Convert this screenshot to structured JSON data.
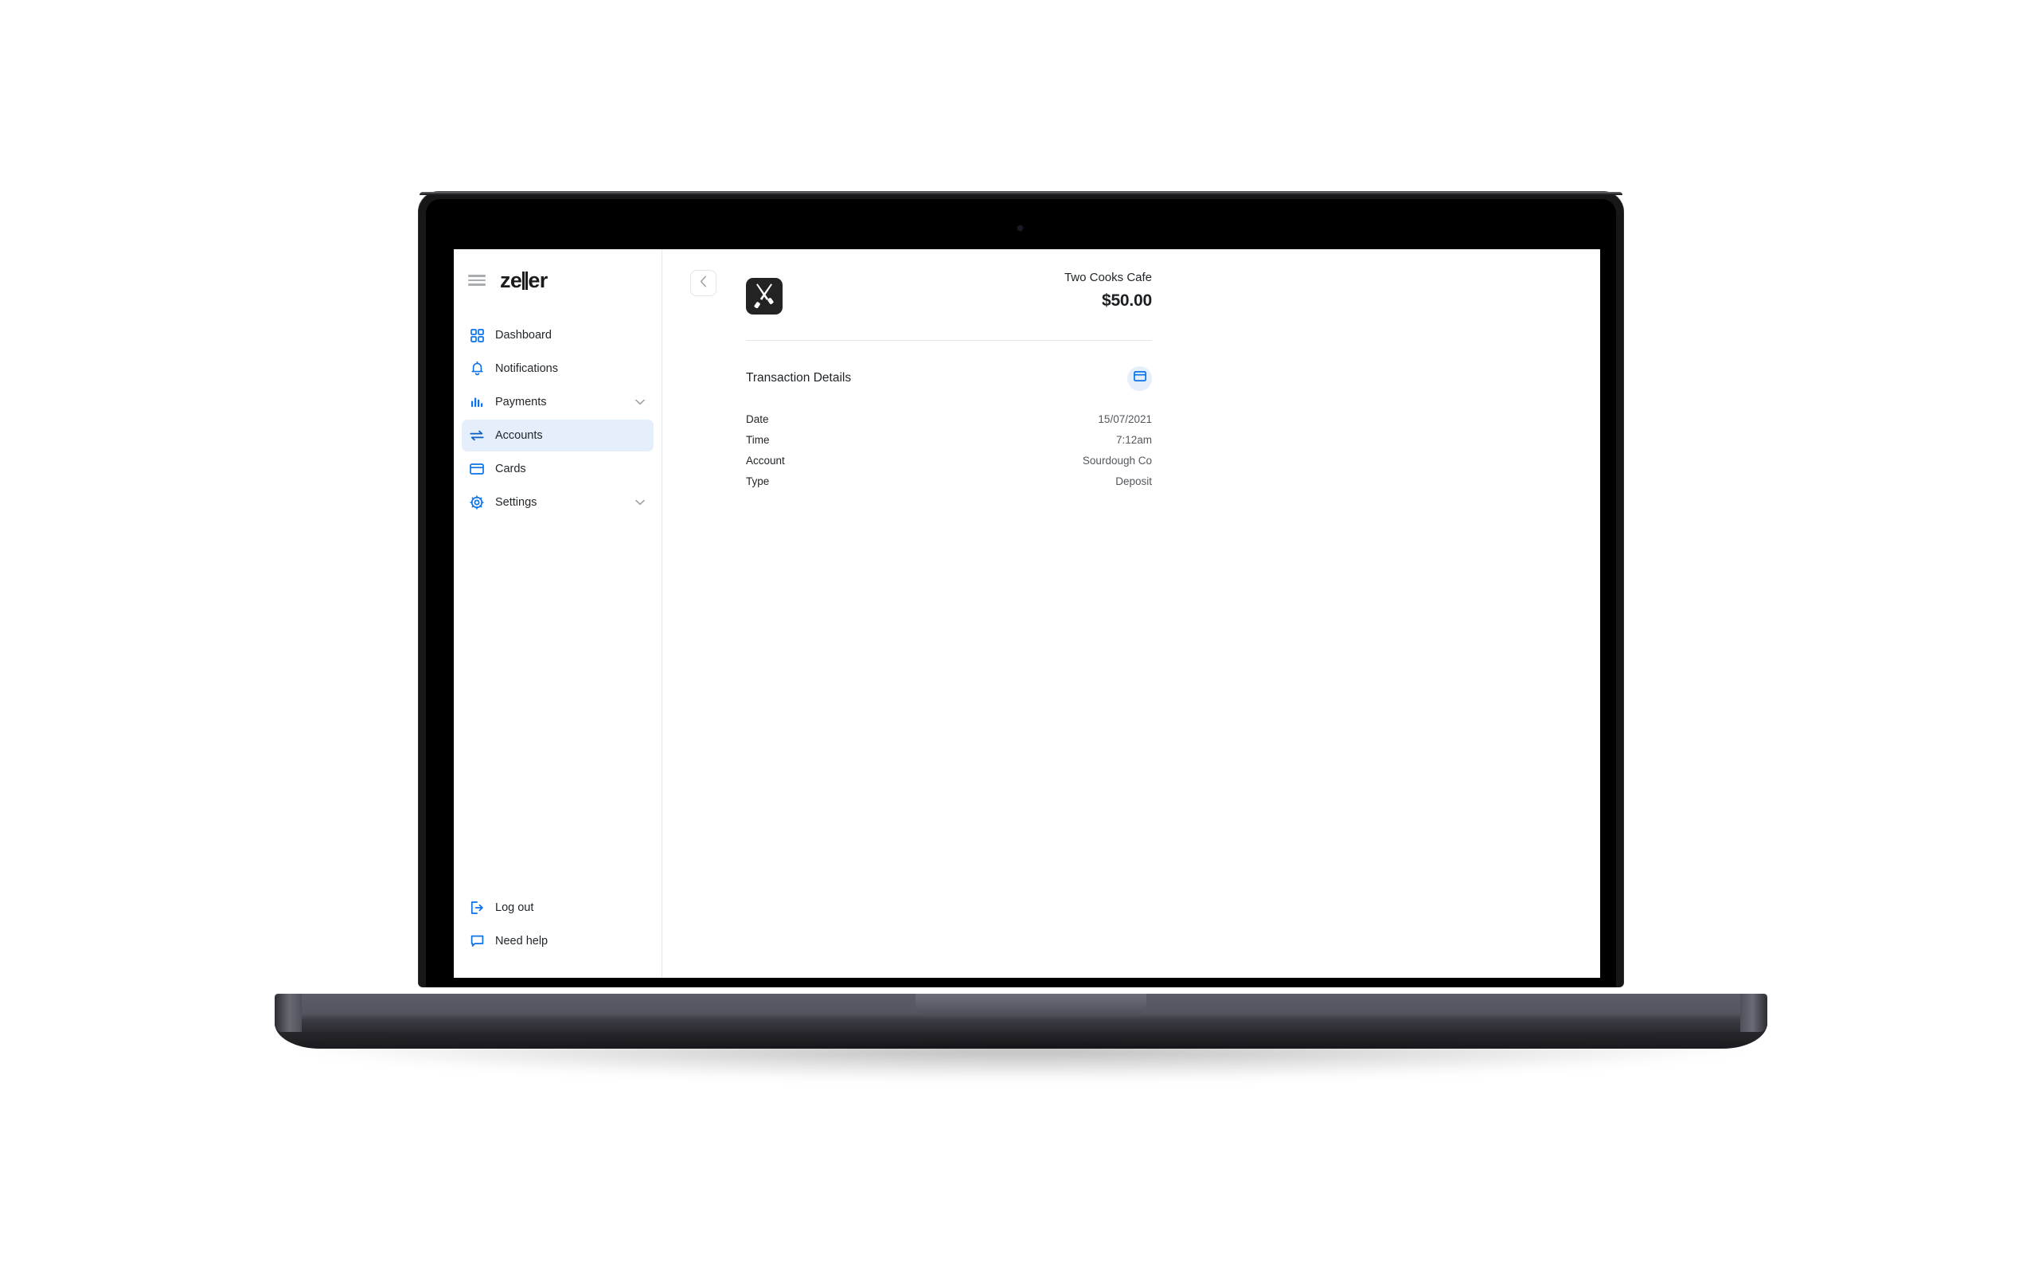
{
  "brand": {
    "name": "zeller",
    "name_part1": "ze",
    "name_part2": "er",
    "accent_color": "#0b72e7",
    "active_nav_bg": "#e4effb"
  },
  "sidebar": {
    "menu_icon": "hamburger-icon",
    "nav_items": [
      {
        "label": "Dashboard",
        "icon": "dashboard-grid-icon",
        "active": false,
        "expandable": false
      },
      {
        "label": "Notifications",
        "icon": "bell-icon",
        "active": false,
        "expandable": false
      },
      {
        "label": "Payments",
        "icon": "bar-chart-icon",
        "active": false,
        "expandable": true
      },
      {
        "label": "Accounts",
        "icon": "transfer-arrows-icon",
        "active": true,
        "expandable": false
      },
      {
        "label": "Cards",
        "icon": "card-icon",
        "active": false,
        "expandable": false
      },
      {
        "label": "Settings",
        "icon": "gear-icon",
        "active": false,
        "expandable": true
      }
    ],
    "footer_items": [
      {
        "label": "Log out",
        "icon": "logout-icon"
      },
      {
        "label": "Need help",
        "icon": "chat-bubble-icon"
      }
    ]
  },
  "transaction": {
    "back_button_icon": "chevron-left-icon",
    "merchant_logo_icon": "crossed-knives-icon",
    "merchant_name": "Two Cooks Cafe",
    "amount": "$50.00",
    "details_title": "Transaction Details",
    "payment_method_icon": "card-icon",
    "rows": [
      {
        "label": "Date",
        "value": "15/07/2021"
      },
      {
        "label": "Time",
        "value": "7:12am"
      },
      {
        "label": "Account",
        "value": "Sourdough Co"
      },
      {
        "label": "Type",
        "value": "Deposit"
      }
    ]
  }
}
